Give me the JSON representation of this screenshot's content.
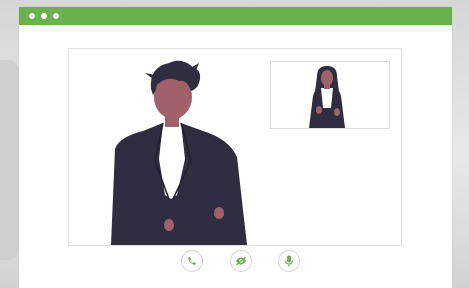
{
  "window": {
    "titlebar_color": "#6ab04c",
    "titlebar_controls": [
      "dot",
      "dot",
      "dot"
    ]
  },
  "main_video": {
    "participant": "main-participant",
    "icon": "person-illustration"
  },
  "pip_video": {
    "participant": "self-view-participant",
    "icon": "person-illustration"
  },
  "controls": [
    {
      "name": "call-button",
      "icon": "phone-icon"
    },
    {
      "name": "camera-button",
      "icon": "eye-slash-icon"
    },
    {
      "name": "mic-button",
      "icon": "microphone-icon"
    }
  ],
  "colors": {
    "accent": "#6ab04c",
    "suit": "#2f2e41",
    "hair": "#2f2e41",
    "skin": "#a0616a",
    "shirt": "#ffffff"
  }
}
